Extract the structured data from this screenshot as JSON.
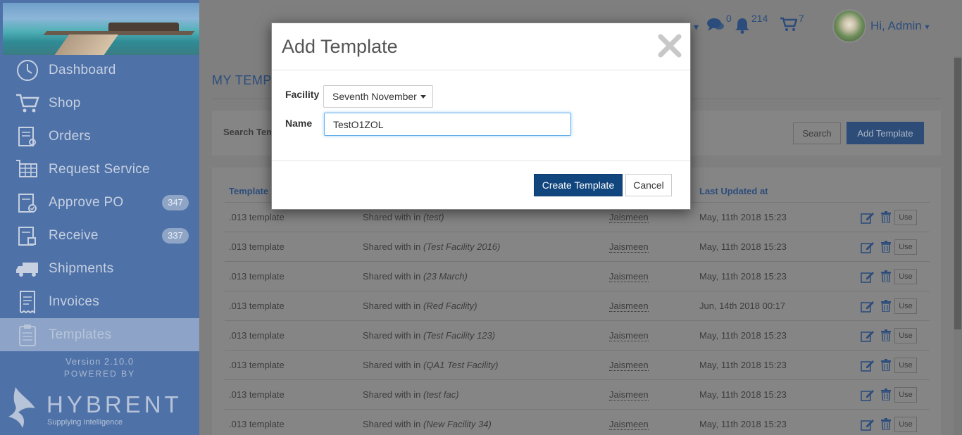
{
  "sidebar": {
    "items": [
      {
        "label": "Dashboard",
        "icon": "clock-icon"
      },
      {
        "label": "Shop",
        "icon": "cart-icon"
      },
      {
        "label": "Orders",
        "icon": "orders-icon"
      },
      {
        "label": "Request Service",
        "icon": "request-service-icon"
      },
      {
        "label": "Approve PO",
        "icon": "approve-icon",
        "badge": "347"
      },
      {
        "label": "Receive",
        "icon": "receive-icon",
        "badge": "337"
      },
      {
        "label": "Shipments",
        "icon": "truck-icon"
      },
      {
        "label": "Invoices",
        "icon": "invoice-icon"
      },
      {
        "label": "Templates",
        "icon": "clipboard-icon",
        "active": true
      }
    ],
    "version": "Version 2.10.0",
    "powered_by": "POWERED BY",
    "brand_name": "HYBRENT",
    "brand_tagline": "Supplying Intelligence"
  },
  "header": {
    "messages_count": "0",
    "notifications_count": "214",
    "cart_count": "7",
    "greeting": "Hi, Admin"
  },
  "main": {
    "page_title": "MY TEMPLATES",
    "search_label": "Search Templates",
    "search_button": "Search",
    "add_button": "Add Template",
    "columns": {
      "template": "Template",
      "last_updated": "Last Updated at"
    },
    "shared_prefix": "Shared with in",
    "use_label": "Use",
    "rows": [
      {
        "name": ".013 template",
        "facility": "(test)",
        "user": "Jaismeen",
        "updated": "May, 11th 2018 15:23"
      },
      {
        "name": ".013 template",
        "facility": "(Test Facility 2016)",
        "user": "Jaismeen",
        "updated": "May, 11th 2018 15:23"
      },
      {
        "name": ".013 template",
        "facility": "(23 March)",
        "user": "Jaismeen",
        "updated": "May, 11th 2018 15:23"
      },
      {
        "name": ".013 template",
        "facility": "(Red Facility)",
        "user": "Jaismeen",
        "updated": "Jun, 14th 2018 00:17"
      },
      {
        "name": ".013 template",
        "facility": "(Test Facility 123)",
        "user": "Jaismeen",
        "updated": "May, 11th 2018 15:23"
      },
      {
        "name": ".013 template",
        "facility": "(QA1 Test Facility)",
        "user": "Jaismeen",
        "updated": "May, 11th 2018 15:23"
      },
      {
        "name": ".013 template",
        "facility": "(test fac)",
        "user": "Jaismeen",
        "updated": "May, 11th 2018 15:23"
      },
      {
        "name": ".013 template",
        "facility": "(New Facility 34)",
        "user": "Jaismeen",
        "updated": "May, 11th 2018 15:23"
      }
    ]
  },
  "modal": {
    "title": "Add Template",
    "facility_label": "Facility",
    "facility_value": "Seventh November",
    "name_label": "Name",
    "name_value": "TestO1ZOL",
    "create_button": "Create Template",
    "cancel_button": "Cancel"
  },
  "colors": {
    "primary": "#10457e",
    "sidebar": "#4e71a8",
    "link": "#2c4d7c"
  }
}
